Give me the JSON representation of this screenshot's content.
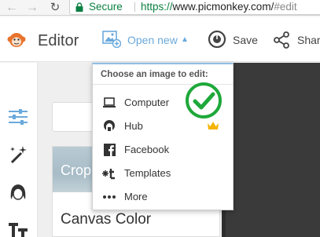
{
  "browser": {
    "back_icon": "arrow-left-icon",
    "forward_icon": "arrow-right-icon",
    "reload_icon": "reload-icon",
    "secure_label": "Secure",
    "url_scheme": "https://",
    "url_host": "www.picmonkey.com/",
    "url_path": "#edit"
  },
  "header": {
    "editor_label": "Editor",
    "open_new_label": "Open new",
    "save_label": "Save",
    "share_label": "Share"
  },
  "panel": {
    "crop_label": "Crop",
    "canvas_color_label": "Canvas Color"
  },
  "dropdown": {
    "heading": "Choose an image to edit:",
    "items": [
      {
        "label": "Computer",
        "icon": "laptop-icon"
      },
      {
        "label": "Hub",
        "icon": "hub-icon"
      },
      {
        "label": "Facebook",
        "icon": "facebook-icon"
      },
      {
        "label": "Templates",
        "icon": "templates-icon"
      },
      {
        "label": "More",
        "icon": "more-dots-icon"
      }
    ]
  },
  "colors": {
    "accent_blue": "#6aa9dc",
    "check_green": "#1ea83a",
    "crown_gold": "#f4b400",
    "workspace": "#3a3a3a"
  }
}
